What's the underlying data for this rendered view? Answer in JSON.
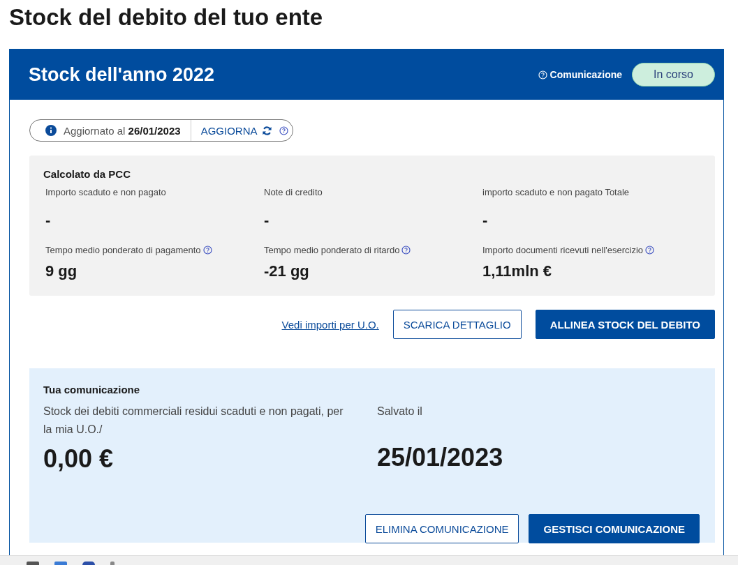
{
  "page_title": "Stock del debito del tuo ente",
  "card": {
    "title": "Stock dell'anno 2022",
    "status_label": "Comunicazione",
    "status": "In corso"
  },
  "update_bar": {
    "label": "Aggiornato al",
    "date": "26/01/2023",
    "action": "AGGIORNA"
  },
  "pcc": {
    "title": "Calcolato da PCC",
    "metrics": [
      {
        "label": "Importo scaduto e non pagato",
        "value": "-",
        "help": false
      },
      {
        "label": "Note di credito",
        "value": "-",
        "help": false
      },
      {
        "label": "importo scaduto e non pagato Totale",
        "value": "-",
        "help": false
      },
      {
        "label": "Tempo medio ponderato di pagamento",
        "value": "9 gg",
        "help": true
      },
      {
        "label": "Tempo medio ponderato di ritardo",
        "value": "-21 gg",
        "help": true
      },
      {
        "label": "Importo documenti ricevuti nell'esercizio",
        "value": "1,11mln €",
        "help": true
      }
    ]
  },
  "actions": {
    "link": "Vedi importi per U.O.",
    "secondary": "SCARICA DETTAGLIO",
    "primary": "ALLINEA STOCK DEL DEBITO"
  },
  "communication": {
    "title": "Tua comunicazione",
    "stock_label": "Stock dei debiti commerciali residui scaduti e non pagati, per la mia U.O./",
    "stock_value": "0,00 €",
    "saved_label": "Salvato il",
    "saved_value": "25/01/2023",
    "secondary": "ELIMINA COMUNICAZIONE",
    "primary": "GESTISCI COMUNICAZIONE"
  }
}
